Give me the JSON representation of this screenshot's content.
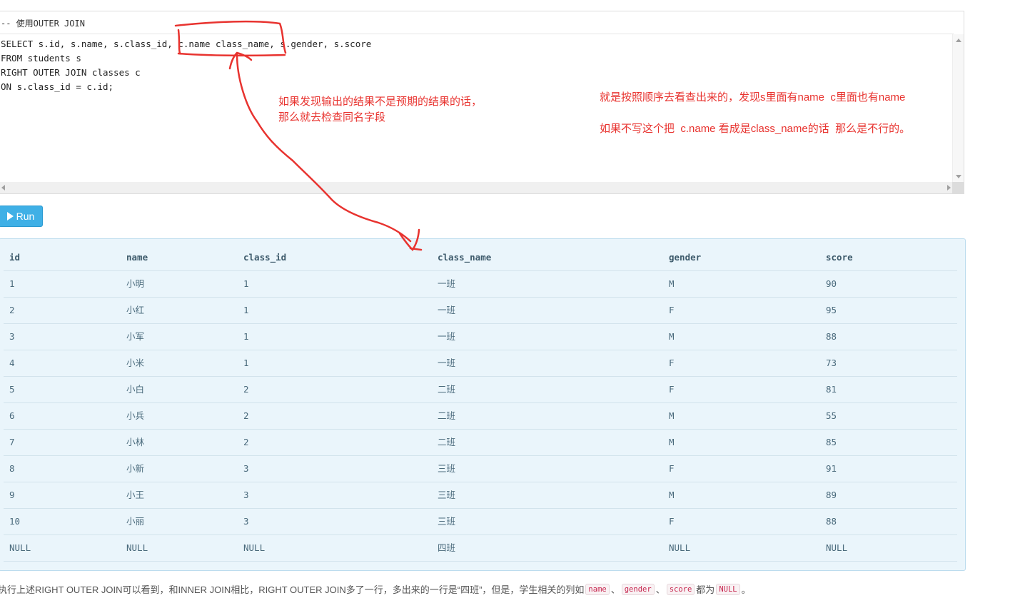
{
  "editor": {
    "comment": "-- 使用OUTER JOIN",
    "code": [
      "SELECT s.id, s.name, s.class_id, c.name class_name, s.gender, s.score",
      "FROM students s",
      "RIGHT OUTER JOIN classes c",
      "ON s.class_id = c.id;"
    ]
  },
  "annotations": {
    "middle": "如果发现输出的结果不是预期的结果的话，\n那么就去检查同名字段",
    "right_line1": "就是按照顺序去看查出来的，发现s里面有name  c里面也有name",
    "right_line2": "如果不写这个把  c.name 看成是class_name的话  那么是不行的。",
    "accent_color": "#e8332f"
  },
  "run_button": {
    "label": "Run",
    "icon": "play-icon",
    "color": "#3fb0e6"
  },
  "result": {
    "columns": [
      "id",
      "name",
      "class_id",
      "class_name",
      "gender",
      "score"
    ],
    "rows": [
      [
        "1",
        "小明",
        "1",
        "一班",
        "M",
        "90"
      ],
      [
        "2",
        "小红",
        "1",
        "一班",
        "F",
        "95"
      ],
      [
        "3",
        "小军",
        "1",
        "一班",
        "M",
        "88"
      ],
      [
        "4",
        "小米",
        "1",
        "一班",
        "F",
        "73"
      ],
      [
        "5",
        "小白",
        "2",
        "二班",
        "F",
        "81"
      ],
      [
        "6",
        "小兵",
        "2",
        "二班",
        "M",
        "55"
      ],
      [
        "7",
        "小林",
        "2",
        "二班",
        "M",
        "85"
      ],
      [
        "8",
        "小新",
        "3",
        "三班",
        "F",
        "91"
      ],
      [
        "9",
        "小王",
        "3",
        "三班",
        "M",
        "89"
      ],
      [
        "10",
        "小丽",
        "3",
        "三班",
        "F",
        "88"
      ],
      [
        "NULL",
        "NULL",
        "NULL",
        "四班",
        "NULL",
        "NULL"
      ]
    ]
  },
  "footer": {
    "text": "执行上述RIGHT OUTER JOIN可以看到，和INNER JOIN相比，RIGHT OUTER JOIN多了一行，多出来的一行是“四班”，但是，学生相关的列如",
    "code1": "name",
    "sep1": "、",
    "code2": "gender",
    "sep2": "、",
    "code3": "score",
    "mid": "都为",
    "code4": "NULL",
    "end": "。"
  }
}
